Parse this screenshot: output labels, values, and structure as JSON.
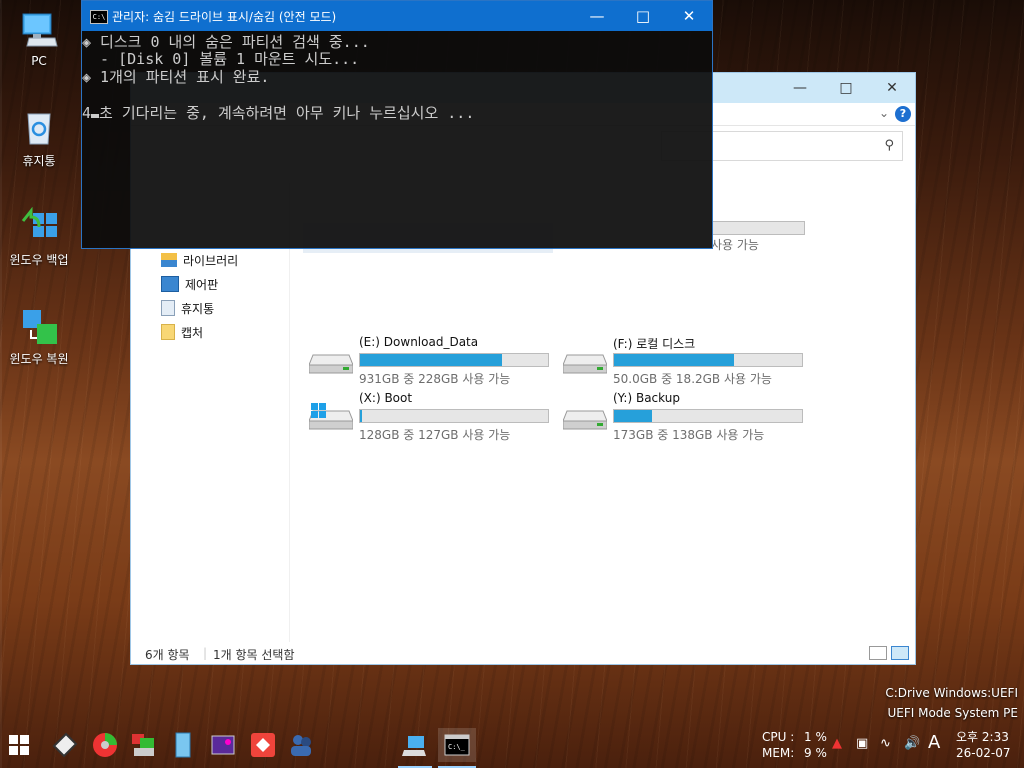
{
  "desktop": {
    "icons": [
      {
        "label": "PC",
        "icon": "computer-icon"
      },
      {
        "label": "휴지통",
        "icon": "recycle-bin-icon"
      },
      {
        "label": "윈도우 백업",
        "icon": "windows-backup-icon"
      },
      {
        "label": "윈도우 복원",
        "icon": "windows-restore-icon"
      }
    ],
    "info_line1": "C:Drive Windows:UEFI",
    "info_line2": "UEFI Mode System PE"
  },
  "cmd": {
    "title": "관리자:  숨김 드라이브 표시/숨김 (안전 모드)",
    "lines": [
      "◈ 디스크 0 내의 숨은 파티션 검색 중...",
      "  - [Disk 0] 볼륨 1 마운트 시도...",
      "◈ 1개의 파티션 표시 완료.",
      "",
      "4"
    ],
    "line5_rest": "초 기다리는 중, 계속하려면 아무 키나 누르십시오 ..."
  },
  "explorer": {
    "nav_items": [
      {
        "label": "라이브러리",
        "icon": "library-icon"
      },
      {
        "label": "제어판",
        "icon": "control-panel-icon"
      },
      {
        "label": "휴지통",
        "icon": "recycle-bin-icon"
      },
      {
        "label": "캡처",
        "icon": "folder-icon"
      }
    ],
    "drives": [
      {
        "name": "(E:) Download_Data",
        "caption": "931GB 중 228GB 사용 가능",
        "used_fraction": 0.755,
        "icon": "hdd-icon"
      },
      {
        "name": "(F:) 로컬 디스크",
        "caption": "50.0GB 중 18.2GB 사용 가능",
        "used_fraction": 0.636,
        "icon": "hdd-icon"
      },
      {
        "name": "(X:) Boot",
        "caption": "128GB 중 127GB 사용 가능",
        "used_fraction": 0.008,
        "icon": "windows-drive-icon"
      },
      {
        "name": "(Y:) Backup",
        "caption": "173GB 중 138GB 사용 가능",
        "used_fraction": 0.202,
        "icon": "hdd-icon"
      }
    ],
    "partial_drive_caption": "사용 가능",
    "partial_drive_caption2": "사용 가능",
    "status_count": "6개 항목",
    "status_selected": "1개 항목 선택함"
  },
  "taskbar": {
    "cpu_label": "CPU :",
    "cpu_value": "1 %",
    "mem_label": "MEM:",
    "mem_value": "9 %",
    "ime": "A",
    "time": "오후 2:33",
    "date": "26-02-07"
  }
}
